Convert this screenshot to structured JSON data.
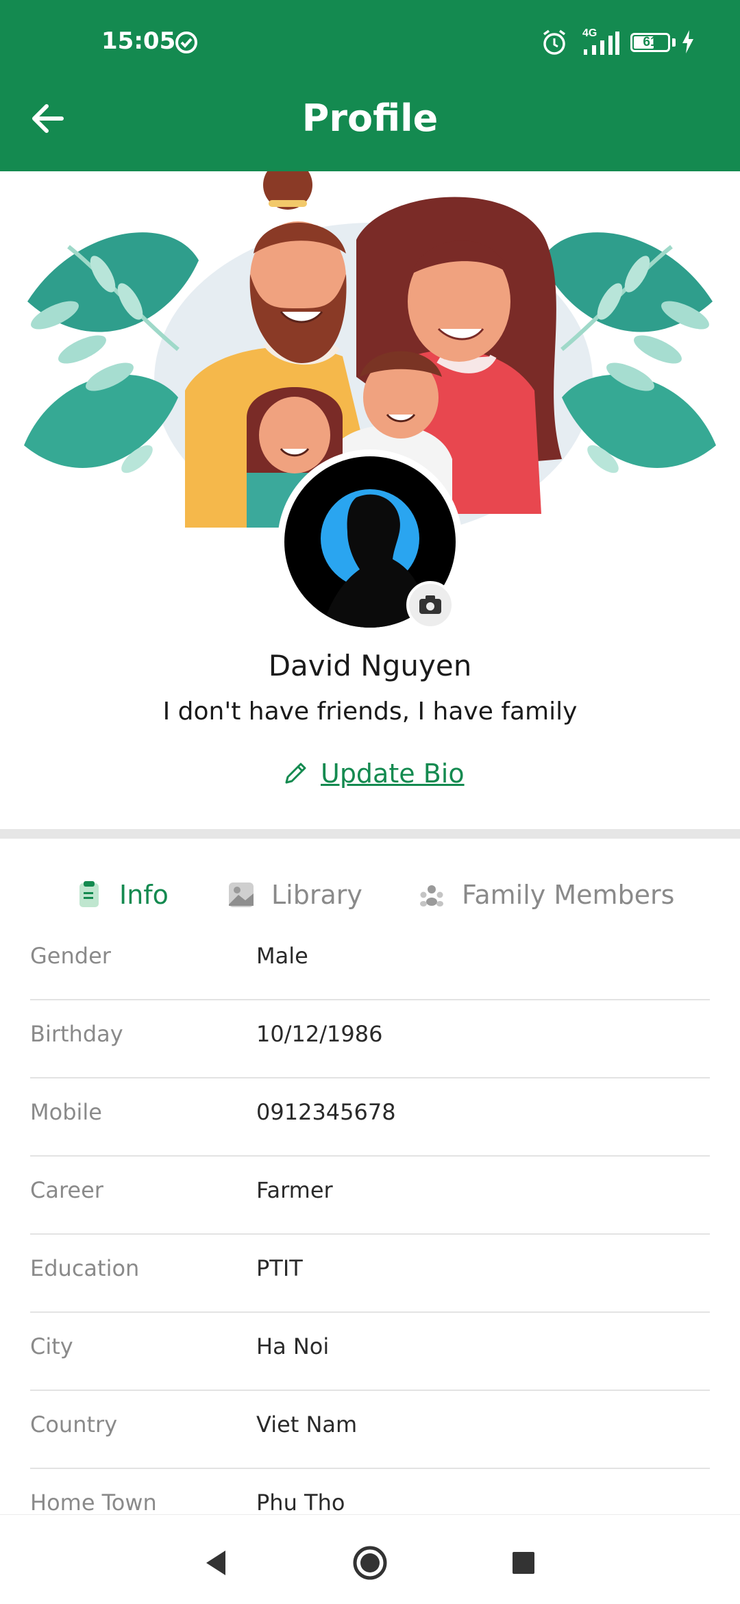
{
  "status_bar": {
    "time": "15:05",
    "network_label": "4G",
    "battery_percent": 61,
    "battery_text": "61",
    "icons": [
      "sync-icon",
      "alarm-icon",
      "signal-icon",
      "battery-icon",
      "charging-icon"
    ]
  },
  "header": {
    "title": "Profile",
    "back_icon": "back-arrow-icon"
  },
  "profile": {
    "name": "David Nguyen",
    "bio": "I don't have friends, I have family",
    "update_bio_label": "Update Bio",
    "camera_icon": "camera-icon"
  },
  "tabs": [
    {
      "label": "Info",
      "icon": "clipboard-icon",
      "active": true
    },
    {
      "label": "Library",
      "icon": "image-icon",
      "active": false
    },
    {
      "label": "Family Members",
      "icon": "group-icon",
      "active": false
    }
  ],
  "info": [
    {
      "key": "Gender",
      "value": "Male"
    },
    {
      "key": "Birthday",
      "value": "10/12/1986"
    },
    {
      "key": "Mobile",
      "value": "0912345678"
    },
    {
      "key": "Career",
      "value": "Farmer"
    },
    {
      "key": "Education",
      "value": "PTIT"
    },
    {
      "key": "City",
      "value": "Ha Noi"
    },
    {
      "key": "Country",
      "value": "Viet Nam"
    },
    {
      "key": "Home Town",
      "value": "Phu Tho"
    }
  ],
  "colors": {
    "primary": "#148a50",
    "inactive_tab": "#8a8a8a",
    "divider": "#e3e3e3"
  },
  "nav": {
    "icons": [
      "nav-back-icon",
      "nav-home-icon",
      "nav-recents-icon"
    ]
  }
}
